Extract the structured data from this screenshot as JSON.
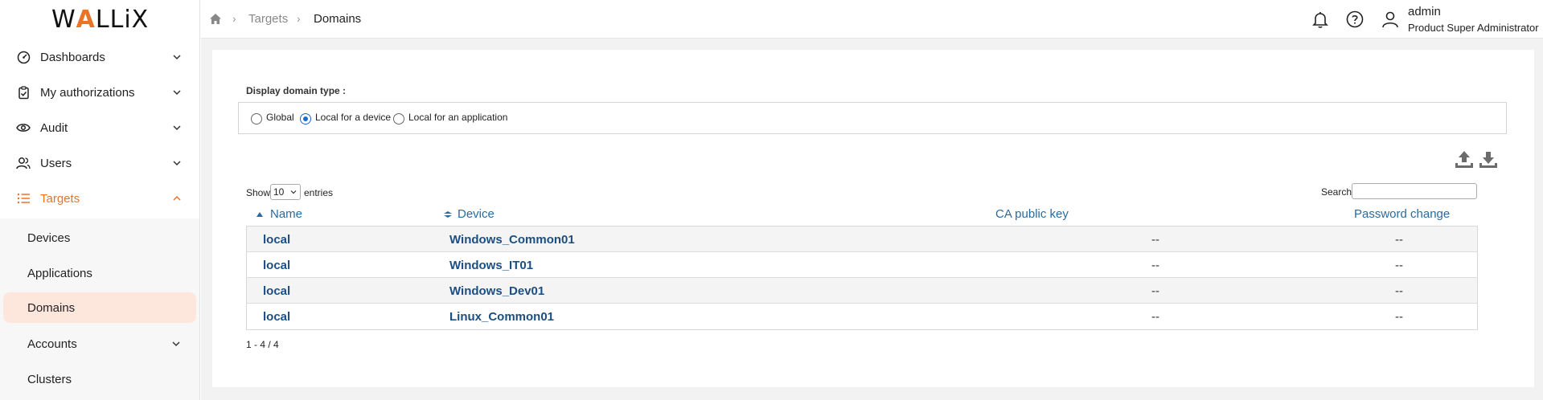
{
  "brand": {
    "logo_left": "W",
    "logo_accent": "A",
    "logo_right": "LLiX"
  },
  "sidebar": {
    "items": [
      {
        "label": "Dashboards",
        "icon": "dashboard-icon"
      },
      {
        "label": "My authorizations",
        "icon": "clipboard-icon"
      },
      {
        "label": "Audit",
        "icon": "eye-icon"
      },
      {
        "label": "Users",
        "icon": "users-icon"
      },
      {
        "label": "Targets",
        "icon": "list-icon",
        "active": true
      }
    ],
    "sub_items": [
      {
        "label": "Devices"
      },
      {
        "label": "Applications"
      },
      {
        "label": "Domains",
        "active": true
      },
      {
        "label": "Accounts"
      },
      {
        "label": "Clusters"
      }
    ]
  },
  "breadcrumb": {
    "home_icon": "home-icon",
    "level1": "Targets",
    "current": "Domains"
  },
  "header": {
    "user_name": "admin",
    "user_role": "Product Super Administrator"
  },
  "filter": {
    "label": "Display domain type :",
    "options": [
      {
        "label": "Global",
        "checked": false
      },
      {
        "label": "Local for a device",
        "checked": true
      },
      {
        "label": "Local for an application",
        "checked": false
      }
    ]
  },
  "table_controls": {
    "show_prefix": "Show",
    "page_size": "10",
    "show_suffix": "entries",
    "search_label": "Search:",
    "search_value": ""
  },
  "table": {
    "columns": [
      "Name",
      "Device",
      "CA public key",
      "Password change"
    ],
    "rows": [
      {
        "name": "local",
        "device": "Windows_Common01",
        "ca_public_key": "--",
        "password_change": "--"
      },
      {
        "name": "local",
        "device": "Windows_IT01",
        "ca_public_key": "--",
        "password_change": "--"
      },
      {
        "name": "local",
        "device": "Windows_Dev01",
        "ca_public_key": "--",
        "password_change": "--"
      },
      {
        "name": "local",
        "device": "Linux_Common01",
        "ca_public_key": "--",
        "password_change": "--"
      }
    ]
  },
  "pagination": {
    "summary": "1 - 4 / 4"
  },
  "colors": {
    "accent": "#e8742a",
    "link": "#1d4e80",
    "header_link": "#2a6a9e",
    "active_bg": "#fde7dd",
    "radio_checked": "#1a6bd0"
  }
}
